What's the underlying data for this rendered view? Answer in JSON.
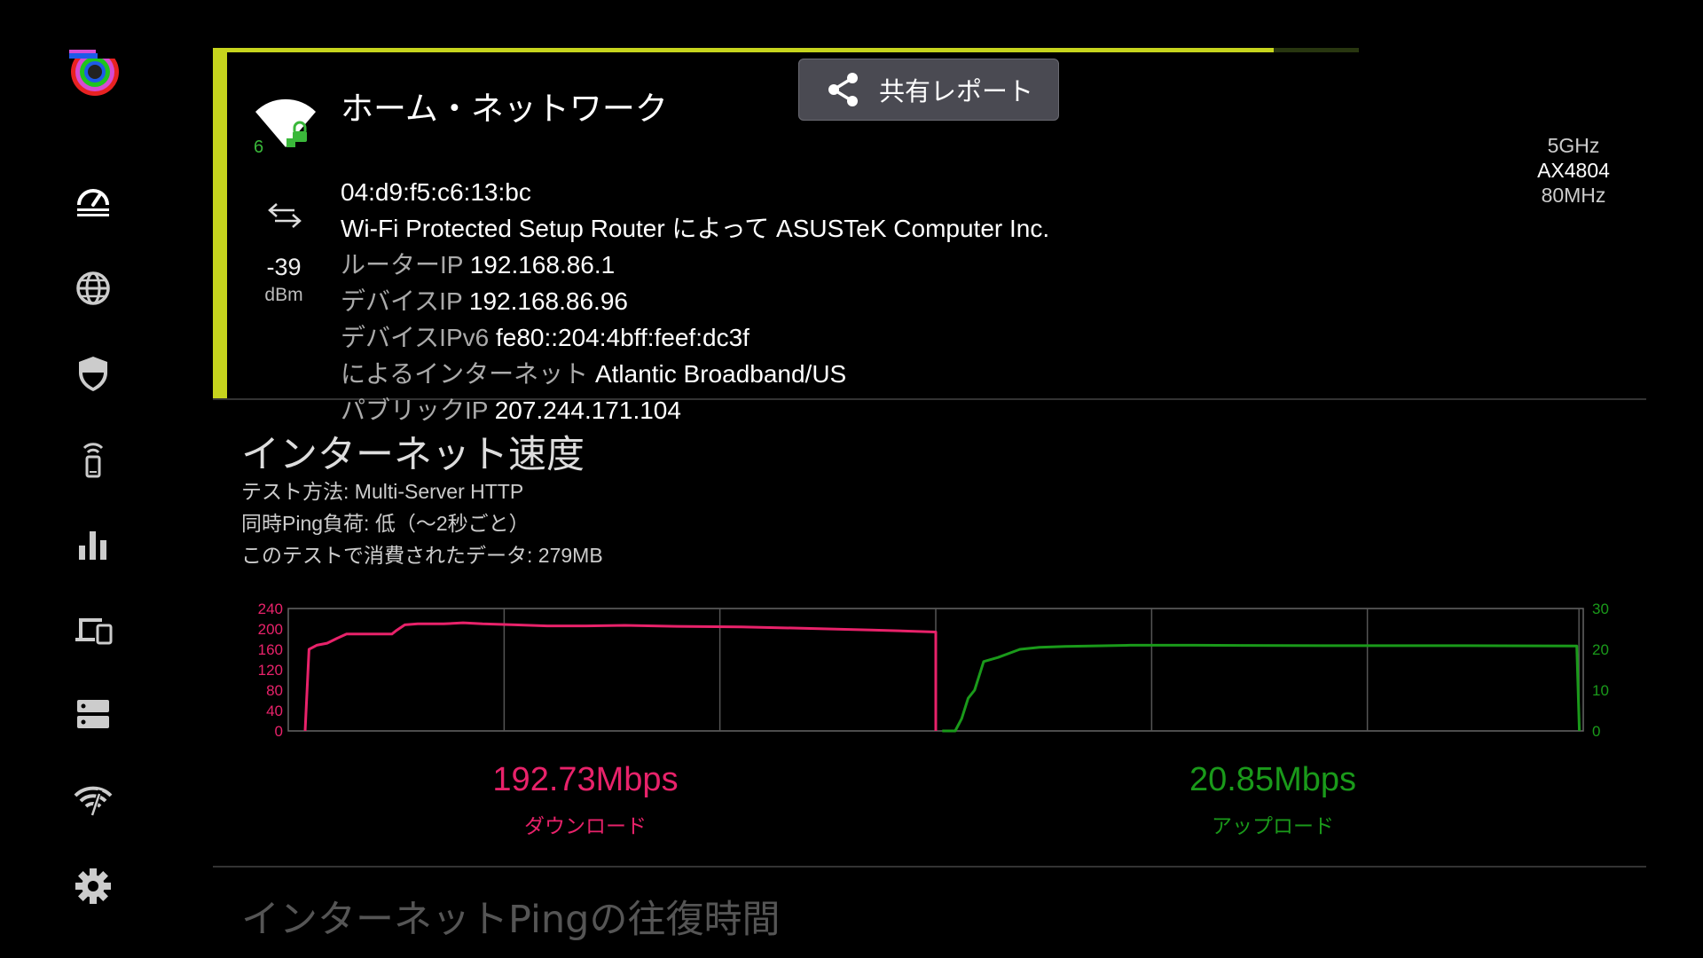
{
  "sidebar": {
    "items": [
      {
        "name": "nav-speedtest",
        "icon": "speedometer-icon",
        "active": true
      },
      {
        "name": "nav-internet",
        "icon": "globe-icon",
        "active": false
      },
      {
        "name": "nav-security",
        "icon": "shield-icon",
        "active": false
      },
      {
        "name": "nav-device-signal",
        "icon": "phone-signal-icon",
        "active": false
      },
      {
        "name": "nav-statistics",
        "icon": "bar-chart-icon",
        "active": false
      },
      {
        "name": "nav-devices",
        "icon": "devices-icon",
        "active": false
      },
      {
        "name": "nav-servers",
        "icon": "server-icon",
        "active": false
      },
      {
        "name": "nav-wifi-scan",
        "icon": "wifi-scan-icon",
        "active": false
      },
      {
        "name": "nav-settings",
        "icon": "gear-icon",
        "active": false
      }
    ]
  },
  "network": {
    "title": "ホーム・ネットワーク",
    "mac": "04:d9:f5:c6:13:bc",
    "router_desc": "Wi-Fi Protected Setup Router によって ASUSTeK Computer Inc.",
    "router_ip_label": "ルーターIP",
    "router_ip": "192.168.86.1",
    "device_ip_label": "デバイスIP",
    "device_ip": "192.168.86.96",
    "device_ipv6_label": "デバイスIPv6",
    "device_ipv6": "fe80::204:4bff:feef:dc3f",
    "isp_label": "によるインターネット",
    "isp": "Atlantic Broadband/US",
    "public_ip_label": "パブリックIP",
    "public_ip": "207.244.171.104",
    "signal_value": "-39",
    "signal_unit": "dBm",
    "wifi_generation": "6",
    "band": "5GHz",
    "model": "AX4804",
    "width": "80MHz",
    "accent_color": "#c6d41d",
    "test_progress": 0.925
  },
  "share_label": "共有レポート",
  "speed": {
    "title": "インターネット速度",
    "method": "テスト方法: Multi-Server HTTP",
    "ping_load": "同時Ping負荷: 低（〜2秒ごと）",
    "data_used": "このテストで消費されたデータ: 279MB",
    "download_value": "192.73Mbps",
    "download_label": "ダウンロード",
    "upload_value": "20.85Mbps",
    "upload_label": "アップロード",
    "download_color": "#e8226a",
    "upload_color": "#1a9a1a"
  },
  "chart_data": {
    "type": "line",
    "series": [
      {
        "name": "ダウンロード",
        "color": "#e8226a",
        "axis": "left",
        "ylim": [
          0,
          240
        ],
        "yticks": [
          0,
          40,
          80,
          120,
          160,
          200,
          240
        ],
        "points": [
          [
            0.013,
            0
          ],
          [
            0.016,
            160
          ],
          [
            0.022,
            168
          ],
          [
            0.03,
            172
          ],
          [
            0.038,
            182
          ],
          [
            0.045,
            190
          ],
          [
            0.055,
            190
          ],
          [
            0.08,
            190
          ],
          [
            0.083,
            196
          ],
          [
            0.09,
            208
          ],
          [
            0.1,
            210
          ],
          [
            0.12,
            210
          ],
          [
            0.135,
            212
          ],
          [
            0.15,
            210
          ],
          [
            0.175,
            208
          ],
          [
            0.2,
            206
          ],
          [
            0.23,
            206
          ],
          [
            0.26,
            207
          ],
          [
            0.3,
            205
          ],
          [
            0.35,
            204
          ],
          [
            0.4,
            201
          ],
          [
            0.45,
            198
          ],
          [
            0.5,
            194
          ],
          [
            0.5,
            0
          ]
        ]
      },
      {
        "name": "アップロード",
        "color": "#1a9a1a",
        "axis": "right",
        "ylim": [
          0,
          30
        ],
        "yticks": [
          0,
          10,
          20,
          30
        ],
        "points": [
          [
            0.505,
            0
          ],
          [
            0.515,
            0
          ],
          [
            0.52,
            3
          ],
          [
            0.525,
            8
          ],
          [
            0.53,
            10
          ],
          [
            0.537,
            17
          ],
          [
            0.548,
            18
          ],
          [
            0.565,
            20
          ],
          [
            0.58,
            20.5
          ],
          [
            0.6,
            20.7
          ],
          [
            0.65,
            21
          ],
          [
            0.7,
            21
          ],
          [
            0.8,
            20.9
          ],
          [
            0.9,
            20.9
          ],
          [
            0.995,
            20.8
          ],
          [
            0.997,
            0
          ]
        ]
      }
    ],
    "x_gridlines": [
      0.1667,
      0.3333,
      0.5,
      0.6667,
      0.8333,
      0.9967
    ]
  },
  "next_section_title": "インターネットPingの往復時間"
}
